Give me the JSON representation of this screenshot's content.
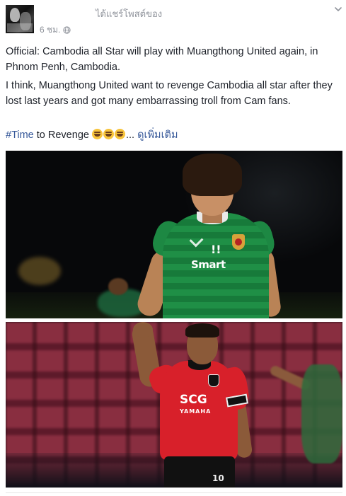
{
  "header": {
    "shared_text": "ได้แชร์โพสต์ของ",
    "time": "6 ชม.",
    "privacy_icon": "globe-icon",
    "menu_icon": "chevron-down-icon"
  },
  "post": {
    "paragraph1": "Official: Cambodia all Star will play with Muangthong United again, in Phnom Penh, Cambodia.",
    "paragraph2": "I think, Muangthong United want to revenge Cambodia all star after they lost last years and got many embarrassing troll from Cam fans.",
    "hashtag": "#Time",
    "paragraph3_text": " to Revenge ",
    "emoji": "tears-of-joy-emoji",
    "ellipsis": "...",
    "see_more": "ดูเพิ่มเติม"
  },
  "photos": {
    "photo1": {
      "sponsor_top": "!!",
      "sponsor": "Smart"
    },
    "photo2": {
      "sponsor": "SCG",
      "sponsor_sub": "YAMAHA",
      "shirt_number": "10"
    }
  },
  "colors": {
    "link": "#365899",
    "meta": "#90949c",
    "text": "#1d2129"
  }
}
